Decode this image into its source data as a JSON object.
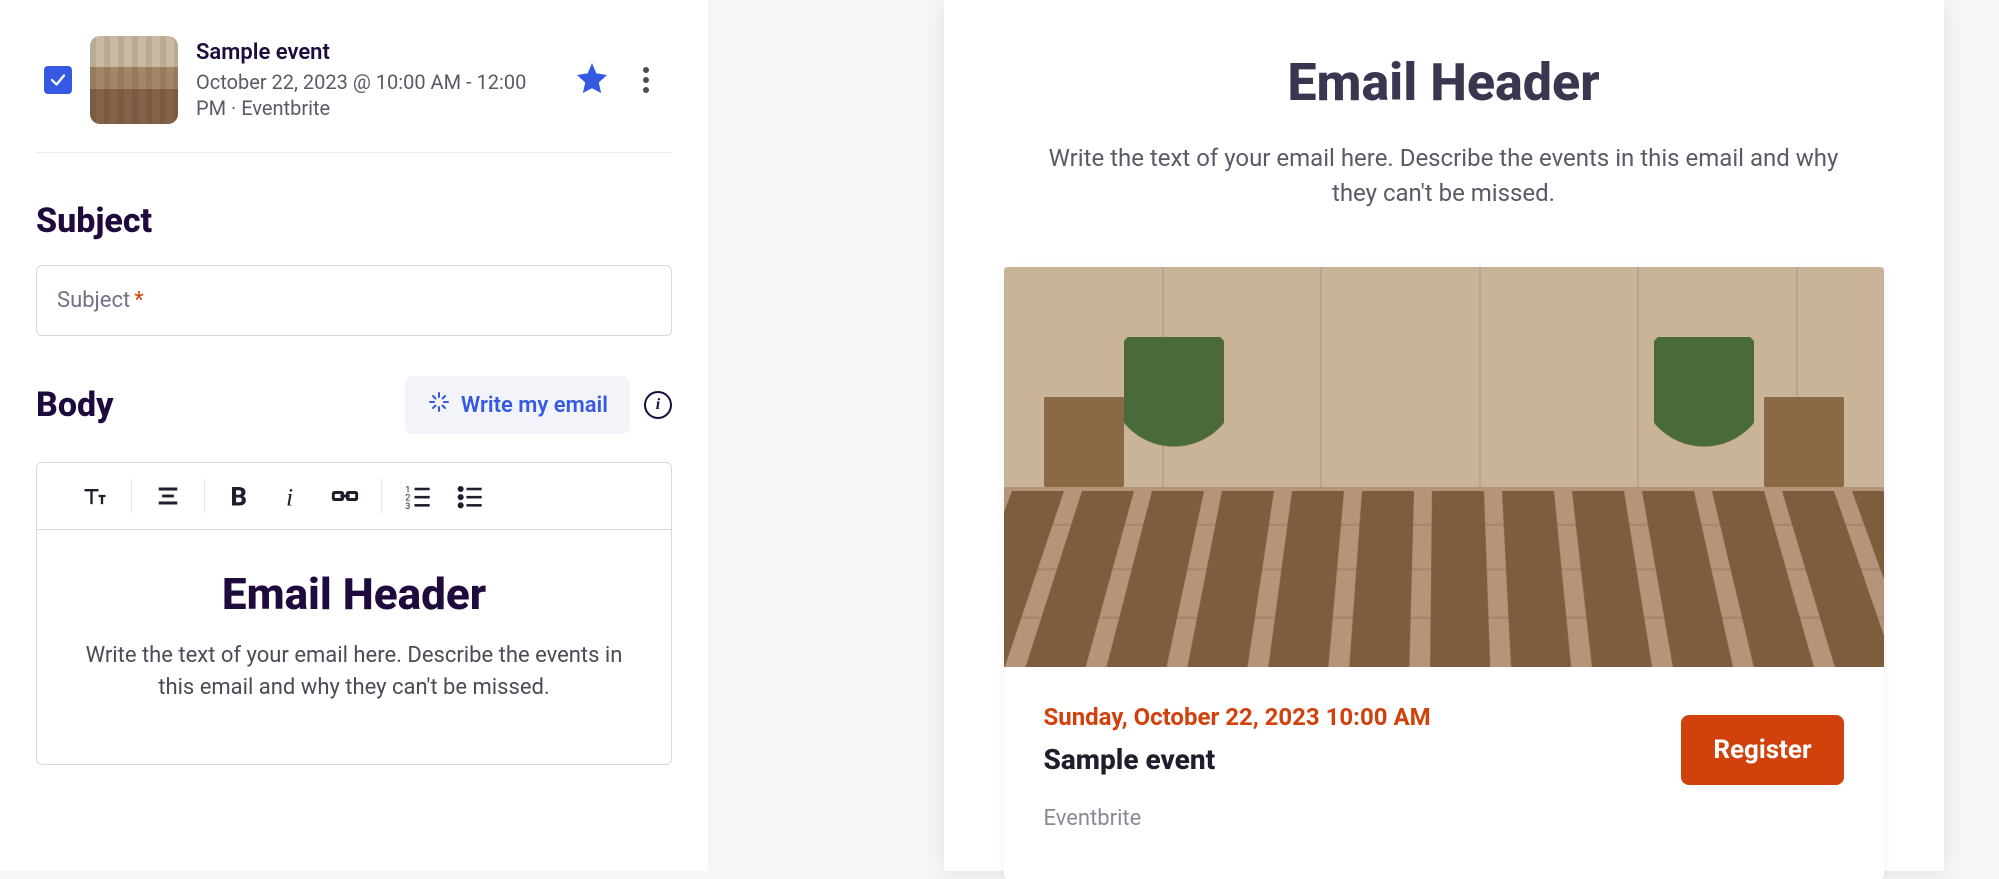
{
  "left": {
    "event": {
      "title": "Sample event",
      "subtitle": "October 22, 2023 @ 10:00 AM - 12:00 PM · Eventbrite"
    },
    "subject_label": "Subject",
    "subject_placeholder": "Subject",
    "subject_required_mark": "*",
    "body_label": "Body",
    "write_email_label": "Write my email",
    "editor": {
      "header": "Email Header",
      "paragraph": "Write the text of your email here. Describe the events in this email and why they can't be missed."
    }
  },
  "right": {
    "header": "Email Header",
    "lede": "Write the text of your email here. Describe the events in this email and why they can't be missed.",
    "card": {
      "when": "Sunday, October 22, 2023 10:00 AM",
      "name": "Sample event",
      "source": "Eventbrite",
      "register_label": "Register"
    }
  }
}
